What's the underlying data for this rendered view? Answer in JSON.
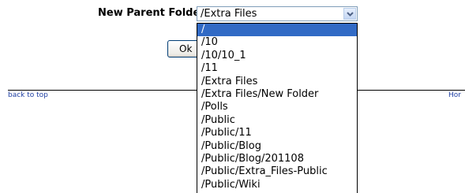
{
  "form": {
    "parent_folder_label": "New Parent Folder:",
    "parent_folder_value": "/Extra Files",
    "ok_label": "Ok"
  },
  "footer": {
    "back_to_top": "back to top",
    "home": "Hor"
  },
  "dropdown": {
    "options": [
      "/",
      "/10",
      "/10/10_1",
      "/11",
      "/Extra Files",
      "/Extra Files/New Folder",
      "/Polls",
      "/Public",
      "/Public/11",
      "/Public/Blog",
      "/Public/Blog/201108",
      "/Public/Extra_Files-Public",
      "/Public/Wiki"
    ],
    "highlighted_index": 0
  },
  "icons": {
    "dropdown_arrow": "chevron-down-icon"
  },
  "colors": {
    "highlight": "#316ac5",
    "link": "#1f3fa3"
  }
}
